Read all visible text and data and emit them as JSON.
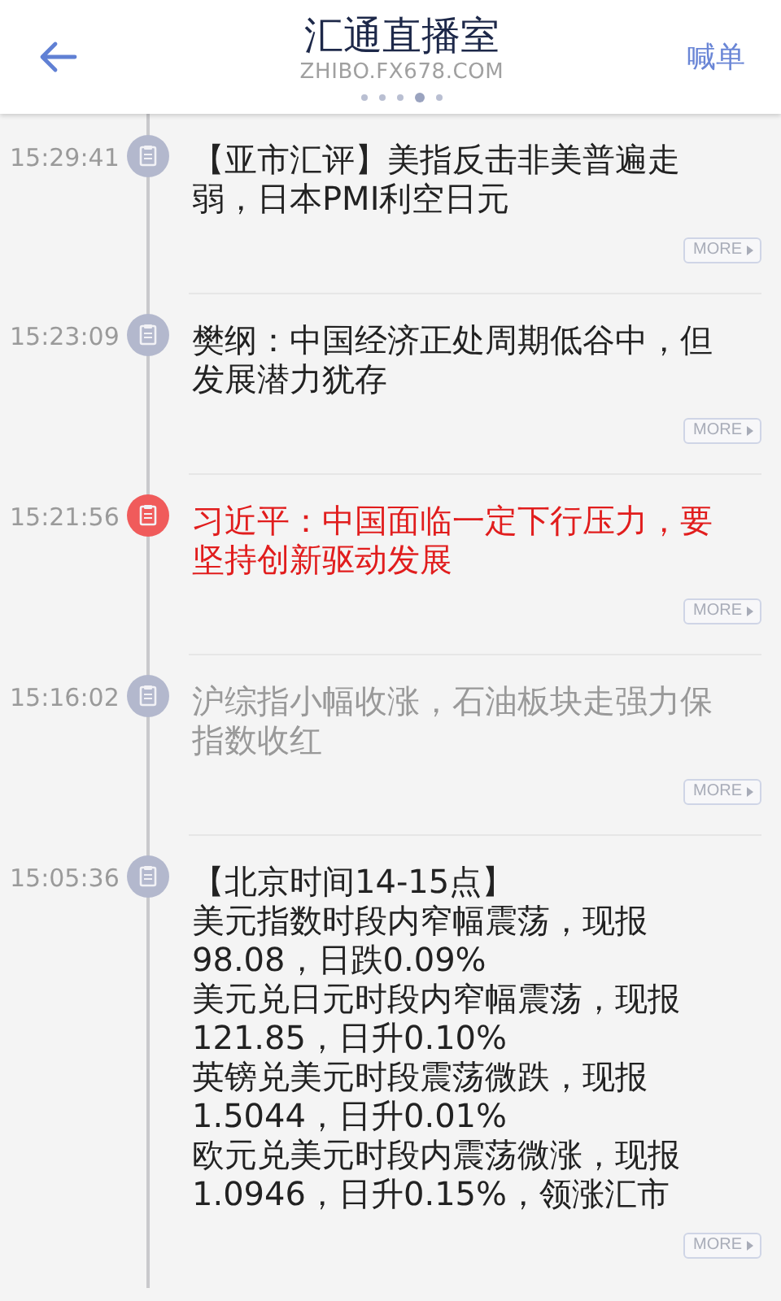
{
  "header": {
    "title": "汇通直播室",
    "subtitle": "ZHIBO.FX678.COM",
    "action": "喊单",
    "pager": [
      {
        "selected": false
      },
      {
        "selected": false
      },
      {
        "selected": false
      },
      {
        "selected": true
      },
      {
        "selected": false
      }
    ]
  },
  "items": [
    {
      "time": "15:29:41",
      "kind": "normal",
      "paragraphs": [
        "【亚市汇评】美指反击非美普遍走弱，日本PMI利空日元"
      ],
      "more": "MORE"
    },
    {
      "time": "15:23:09",
      "kind": "normal",
      "paragraphs": [
        "樊纲：中国经济正处周期低谷中，但发展潜力犹存"
      ],
      "more": "MORE"
    },
    {
      "time": "15:21:56",
      "kind": "important",
      "paragraphs": [
        "习近平：中国面临一定下行压力，要坚持创新驱动发展"
      ],
      "more": "MORE"
    },
    {
      "time": "15:16:02",
      "kind": "muted",
      "paragraphs": [
        "沪综指小幅收涨，石油板块走强力保指数收红"
      ],
      "more": "MORE"
    },
    {
      "time": "15:05:36",
      "kind": "normal",
      "paragraphs": [
        "【北京时间14-15点】",
        "美元指数时段内窄幅震荡，现报98.08，日跌0.09%",
        "美元兑日元时段内窄幅震荡，现报121.85，日升0.10%",
        "英镑兑美元时段震荡微跌，现报1.5044，日升0.01%",
        "欧元兑美元时段内震荡微涨，现报1.0946，日升0.15%，领涨汇市"
      ],
      "more": "MORE"
    }
  ]
}
